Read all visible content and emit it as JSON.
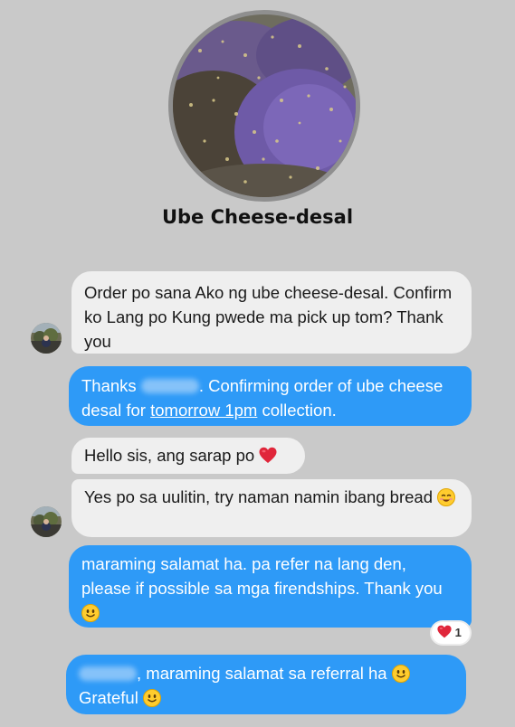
{
  "chat": {
    "title": "Ube Cheese-desal"
  },
  "messages": [
    {
      "side": "incoming",
      "text": "Order po sana Ako ng ube cheese-desal. Confirm ko Lang po Kung pwede ma pick up tom? Thank you"
    },
    {
      "side": "outgoing",
      "text_a": "Thanks",
      "text_b": ". Confirming order of ube cheese desal for",
      "link": "tomorrow 1pm",
      "text_c": "collection."
    },
    {
      "side": "incoming",
      "text": "Hello sis, ang sarap po",
      "emoji": "red-heart"
    },
    {
      "side": "incoming",
      "text": "Yes po sa uulitin, try naman namin ibang bread",
      "emoji": "smiling-face"
    },
    {
      "side": "outgoing",
      "text": "maraming salamat ha. pa refer na lang den, please if possible sa mga firendships. Thank you",
      "emoji": "slightly-smiling-face",
      "reaction": {
        "emoji": "heart",
        "count": "1"
      }
    },
    {
      "side": "outgoing",
      "text_a": ", maraming salamat sa referral ha",
      "text_b": "Grateful",
      "emoji": "slightly-smiling-face"
    }
  ],
  "colors": {
    "background": "#c9c9c9",
    "incoming_bubble": "#efefef",
    "outgoing_bubble": "#2e9af7",
    "heart": "#e0263a"
  }
}
